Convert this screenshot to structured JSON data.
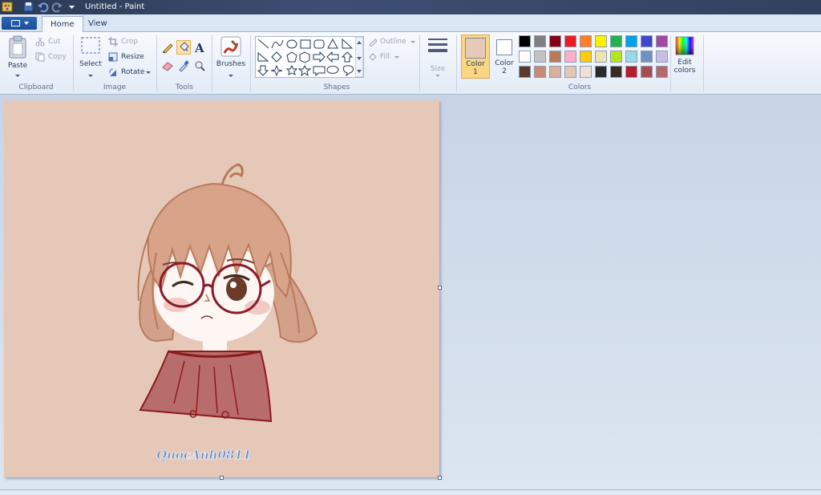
{
  "window": {
    "title": "Untitled - Paint"
  },
  "tabs": {
    "home": "Home",
    "view": "View"
  },
  "clipboard": {
    "paste": "Paste",
    "cut": "Cut",
    "copy": "Copy",
    "label": "Clipboard"
  },
  "image": {
    "select": "Select",
    "crop": "Crop",
    "resize": "Resize",
    "rotate": "Rotate",
    "label": "Image"
  },
  "tools": {
    "label": "Tools"
  },
  "brushes": {
    "label": "Brushes"
  },
  "shapes": {
    "outline": "Outline",
    "fill": "Fill",
    "label": "Shapes"
  },
  "size": {
    "label": "Size"
  },
  "colors": {
    "color1": "Color 1",
    "color1_line1": "Color",
    "color1_line2": "1",
    "color2_line1": "Color",
    "color2_line2": "2",
    "color1_value": "#e6c8b8",
    "color2_value": "#ffffff",
    "edit_line1": "Edit",
    "edit_line2": "colors",
    "label": "Colors",
    "palette": [
      [
        "#000000",
        "#7f7f7f",
        "#880015",
        "#ed1c24",
        "#ff7f27",
        "#fff200",
        "#22b14c",
        "#00a2e8",
        "#3f48cc",
        "#a349a4"
      ],
      [
        "#ffffff",
        "#c3c3c3",
        "#b97a57",
        "#ffaec9",
        "#ffc90e",
        "#efe4b0",
        "#b5e61d",
        "#99d9ea",
        "#7092be",
        "#c8bfe7"
      ],
      [
        "#5a3a2a",
        "#c88a70",
        "#d9b09a",
        "#e3c6b6",
        "#f0e0d6",
        "#2b2b2b",
        "#3a2a22",
        "#b71c2c",
        "#a84c52",
        "#b46a6a"
      ]
    ]
  },
  "artwork": {
    "signature": "QuocAnh0811"
  }
}
